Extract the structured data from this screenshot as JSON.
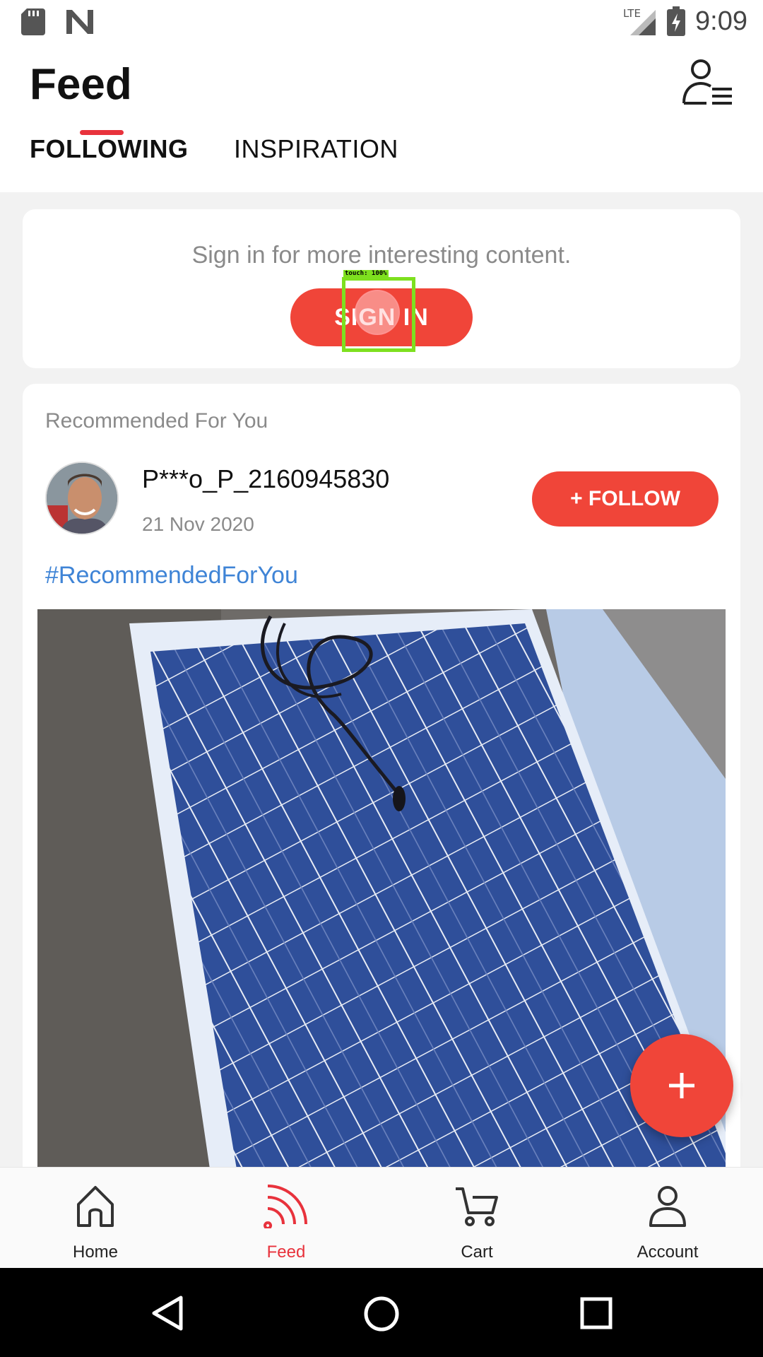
{
  "status_bar": {
    "network": "LTE",
    "time": "9:09"
  },
  "header": {
    "title": "Feed",
    "tabs": [
      {
        "label": "FOLLOWING",
        "active": true
      },
      {
        "label": "INSPIRATION",
        "active": false
      }
    ]
  },
  "signin": {
    "message": "Sign in for more interesting content.",
    "button_label": "SIGN IN",
    "touch_overlay": "touch: 100%"
  },
  "feed": {
    "heading": "Recommended For You",
    "post": {
      "username": "P***o_P_2160945830",
      "date": "21 Nov 2020",
      "follow_label": "+ FOLLOW",
      "hashtag": "#RecommendedForYou"
    }
  },
  "fab": {
    "icon": "plus-icon"
  },
  "bottom_nav": {
    "items": [
      {
        "label": "Home",
        "icon": "home-icon",
        "active": false
      },
      {
        "label": "Feed",
        "icon": "feed-icon",
        "active": true
      },
      {
        "label": "Cart",
        "icon": "cart-icon",
        "active": false
      },
      {
        "label": "Account",
        "icon": "account-icon",
        "active": false
      }
    ]
  },
  "colors": {
    "accent": "#f04539",
    "link": "#3f84d6"
  }
}
